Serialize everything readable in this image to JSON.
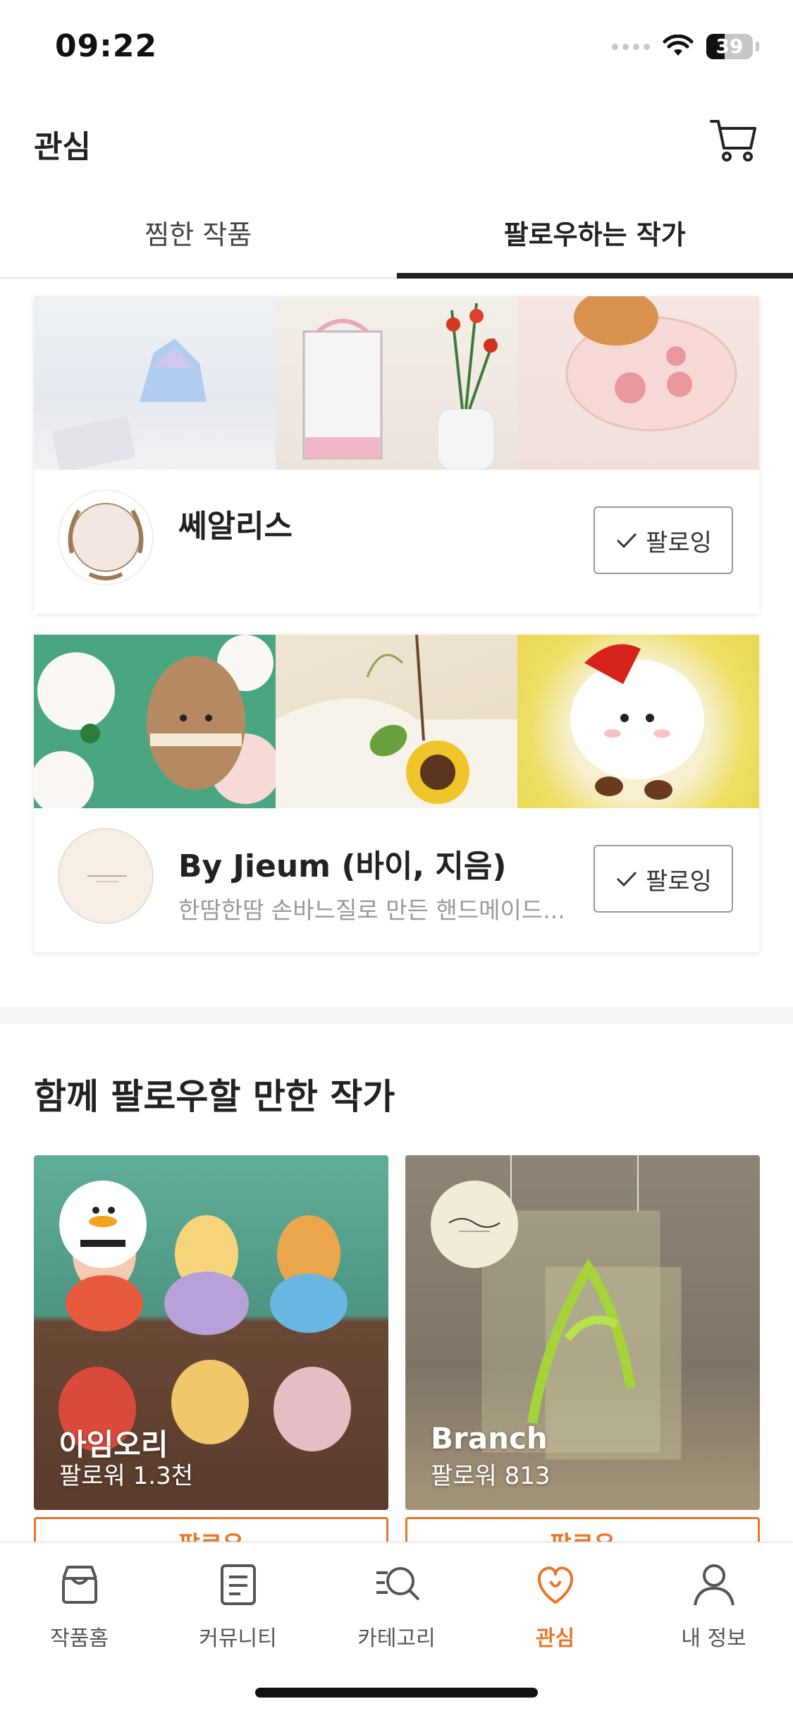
{
  "status_bar": {
    "time": "09:22",
    "battery": "39",
    "battery_level": 0.39
  },
  "header": {
    "title": "관심"
  },
  "tabs": [
    {
      "label": "찜한 작품",
      "active": false
    },
    {
      "label": "팔로우하는 작가",
      "active": true
    }
  ],
  "following": [
    {
      "name": "쎄알리스",
      "description": "",
      "follow_label": "팔로잉"
    },
    {
      "name": "By Jieum (바이, 지음)",
      "description": "한땀한땀 손바느질로 만든 핸드메이드...",
      "follow_label": "팔로잉"
    }
  ],
  "recommend": {
    "title": "함께 팔로우할 만한 작가",
    "artists": [
      {
        "name": "아임오리",
        "followers": "팔로워 1.3천",
        "follow_label": "팔로우"
      },
      {
        "name": "Branch",
        "followers": "팔로워 813",
        "follow_label": "팔로우"
      }
    ]
  },
  "nav": [
    {
      "label": "작품홈",
      "icon": "shop-icon",
      "active": false
    },
    {
      "label": "커뮤니티",
      "icon": "board-icon",
      "active": false
    },
    {
      "label": "카테고리",
      "icon": "category-search-icon",
      "active": false
    },
    {
      "label": "관심",
      "icon": "heart-icon",
      "active": true
    },
    {
      "label": "내 정보",
      "icon": "person-icon",
      "active": false
    }
  ],
  "colors": {
    "accent": "#e9772a",
    "text": "#222222",
    "muted": "#9a9a9a"
  }
}
